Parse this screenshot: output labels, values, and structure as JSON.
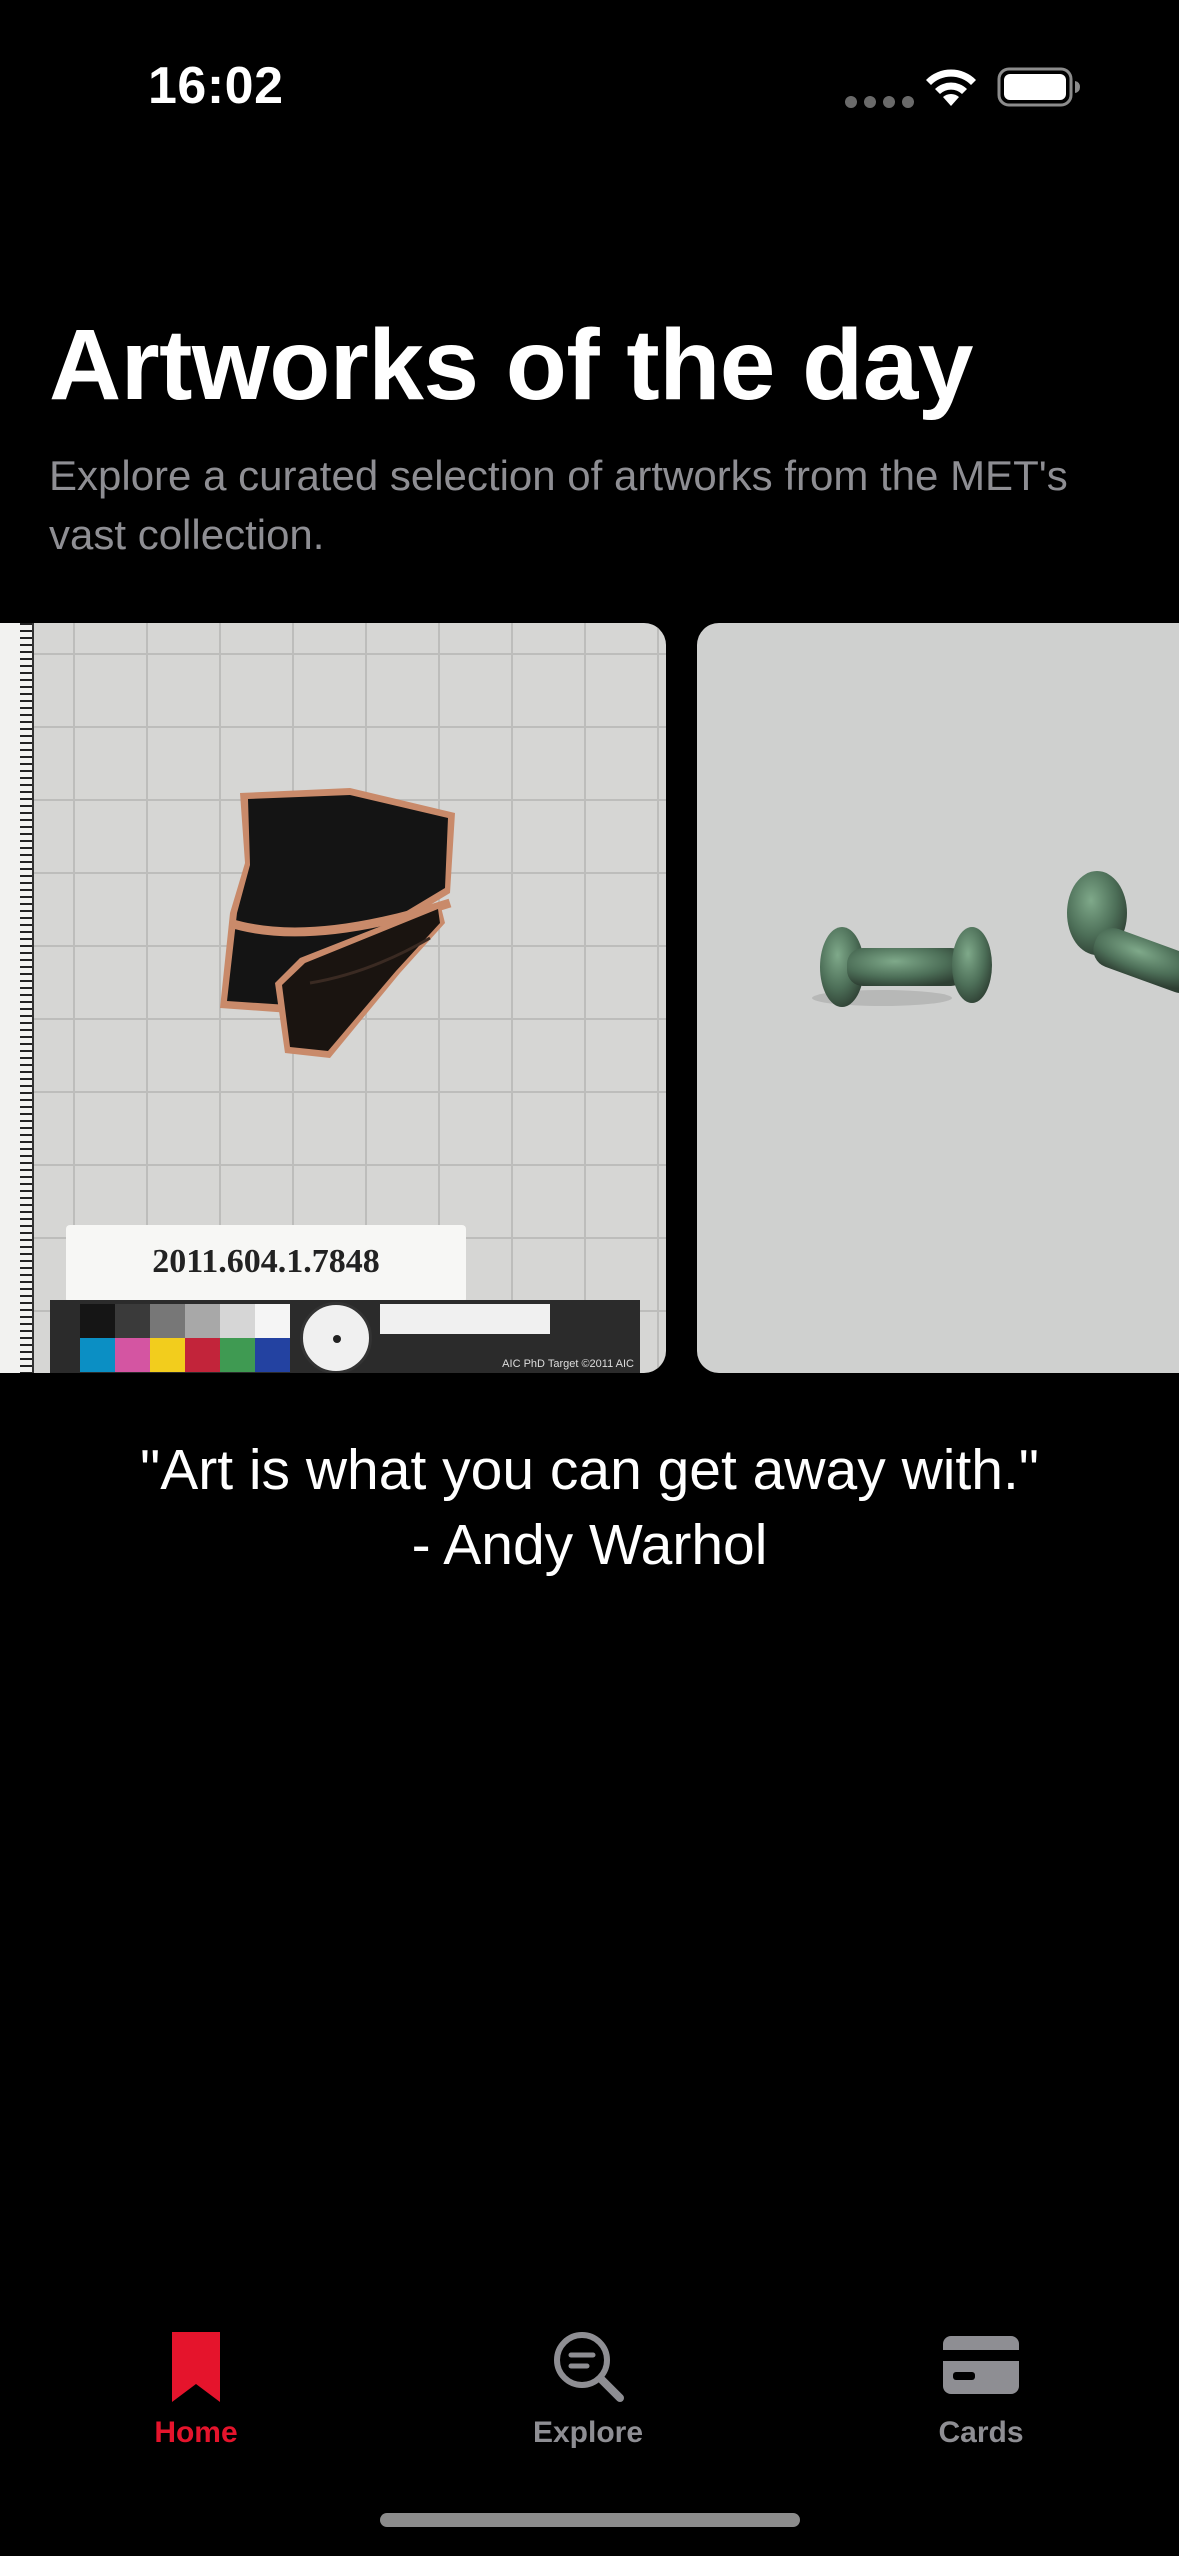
{
  "status_bar": {
    "time": "16:02",
    "icons": [
      "signal-dots-icon",
      "wifi-icon",
      "battery-icon"
    ]
  },
  "header": {
    "title": "Artworks of the day",
    "subtitle": "Explore a curated selection of artworks from the MET's vast collection."
  },
  "carousel": {
    "cards": [
      {
        "subject": "black-glazed pottery fragment on grid with ruler and color target",
        "accession_label": "2011.604.1.7848",
        "target_label": "AIC PhD Target ©2011 AIC"
      },
      {
        "subject": "pair of corroded bronze spools on grey background"
      }
    ]
  },
  "quote": {
    "text": "\"Art is what you can get away with.\"",
    "author": "- Andy Warhol"
  },
  "tab_bar": {
    "active_color": "#e5142c",
    "inactive_color": "#8e8e93",
    "tabs": [
      {
        "label": "Home",
        "icon": "bookmark-icon",
        "active": true
      },
      {
        "label": "Explore",
        "icon": "search-icon",
        "active": false
      },
      {
        "label": "Cards",
        "icon": "card-icon",
        "active": false
      }
    ]
  }
}
